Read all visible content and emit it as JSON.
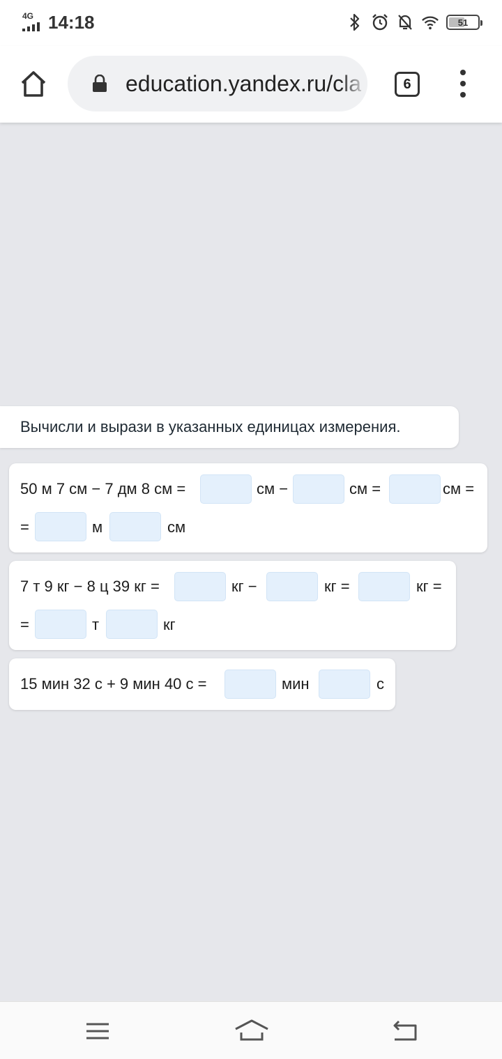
{
  "status_bar": {
    "network": "4G",
    "time": "14:18",
    "battery": "51"
  },
  "browser": {
    "url": "education.yandex.ru/cla",
    "tab_count": "6"
  },
  "task": {
    "instruction": "Вычисли и вырази в указанных единицах измерения.",
    "length_problem": {
      "expression": "50 м 7 см − 7 дм 8 см =",
      "unit_cm_minus": "см −",
      "unit_cm_eq": "см =",
      "unit_cm_eq_2": "см =",
      "eq_sign": "=",
      "unit_m": "м",
      "unit_cm": "см"
    },
    "mass_problem": {
      "expression": "7 т 9 кг − 8 ц 39 кг =",
      "unit_kg_minus": "кг −",
      "unit_kg_eq": "кг =",
      "unit_kg_eq_2": "кг =",
      "eq_sign": "=",
      "unit_t": "т",
      "unit_kg": "кг"
    },
    "time_problem": {
      "expression": "15 мин 32 с + 9 мин 40 с =",
      "unit_min": "мин",
      "unit_s": "с"
    }
  },
  "colors": {
    "page_bg": "#e6e7eb",
    "answer_field": "#e4f0fc",
    "marker": "#e53935"
  }
}
